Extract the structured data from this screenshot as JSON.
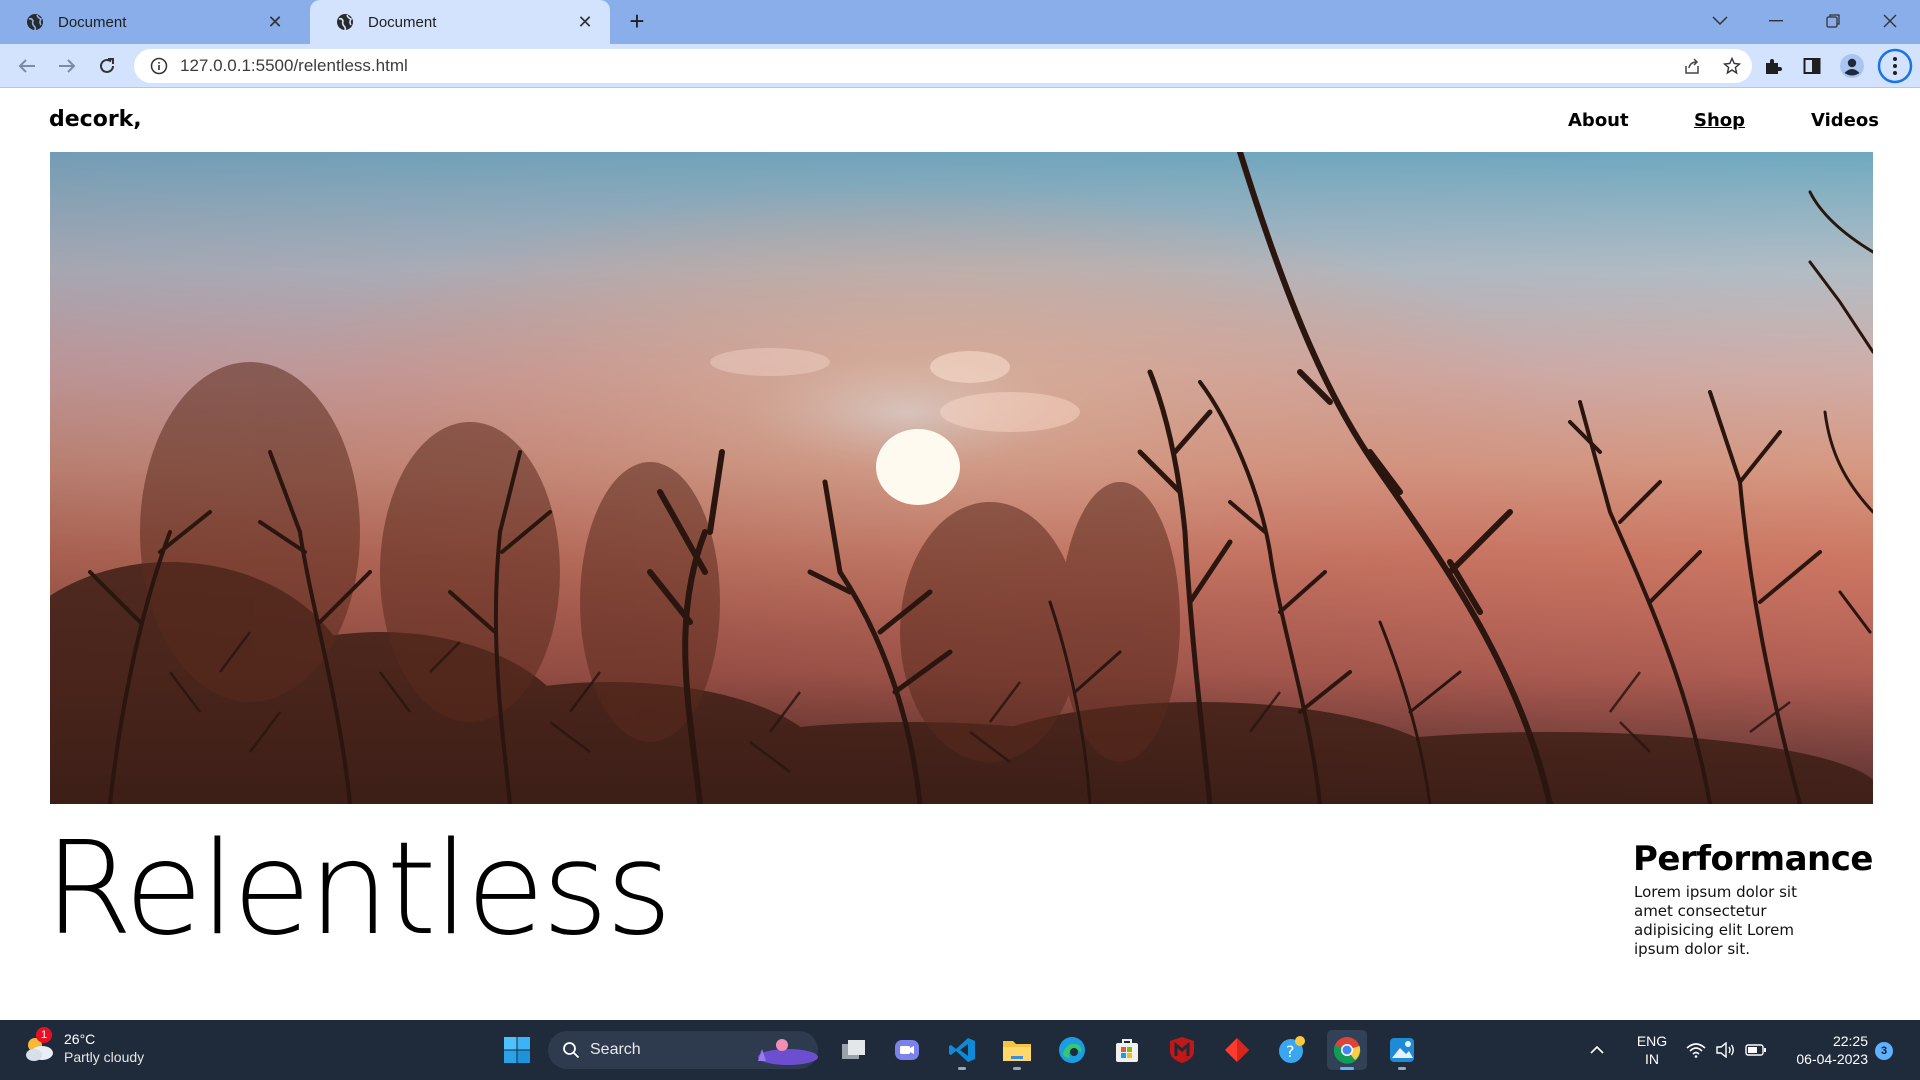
{
  "browser": {
    "tabs": [
      {
        "title": "Document"
      },
      {
        "title": "Document"
      }
    ],
    "address": "127.0.0.1:5500/relentless.html"
  },
  "site": {
    "logo": "decork,",
    "nav": [
      {
        "label": "About"
      },
      {
        "label": "Shop"
      },
      {
        "label": "Videos"
      }
    ],
    "hero_image": "sunset-branches-photo",
    "headline": "Relentless",
    "feature": {
      "title": "Performance",
      "body": "Lorem ipsum dolor sit amet consectetur adipisicing elit Lorem ipsum dolor sit."
    }
  },
  "taskbar": {
    "weather": {
      "temp": "26°C",
      "condition": "Partly cloudy",
      "badge": "1"
    },
    "search_label": "Search",
    "language": {
      "line1": "ENG",
      "line2": "IN"
    },
    "clock": {
      "time": "22:25",
      "date": "06-04-2023"
    },
    "notifications": "3"
  }
}
